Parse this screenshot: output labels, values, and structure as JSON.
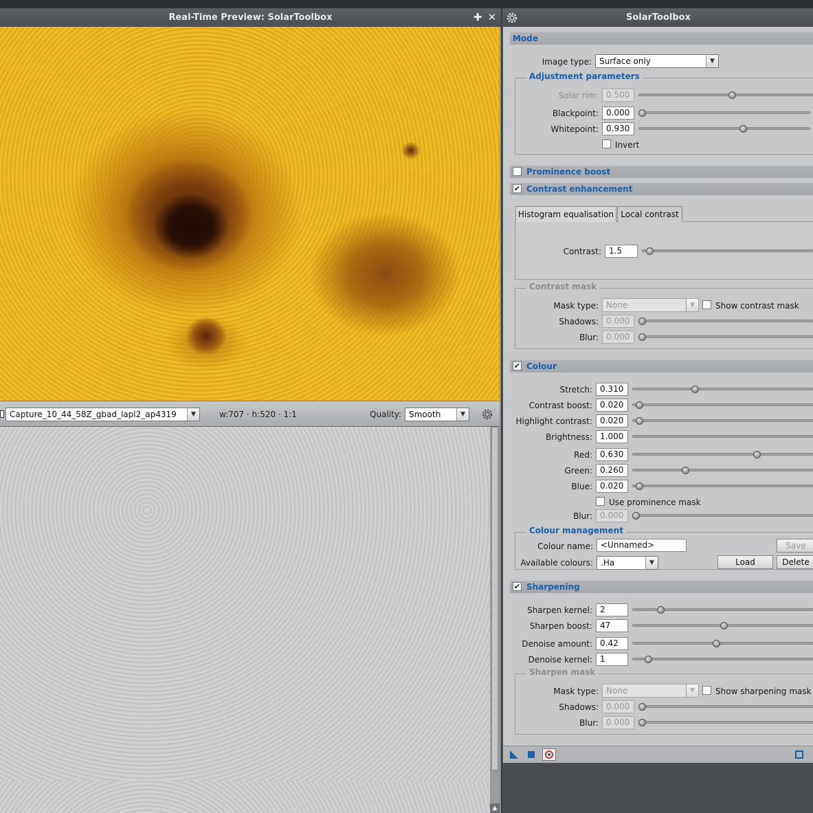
{
  "preview": {
    "title": "Real-Time Preview: SolarToolbox",
    "pin_glyph": "✚",
    "close_glyph": "✕",
    "view_selector": "Capture_10_44_58Z_gbad_lapl2_ap4319",
    "dimensions": "w:707 · h:520 · 1:1",
    "quality_label": "Quality:",
    "quality_value": "Smooth"
  },
  "panel": {
    "title": "SolarToolbox",
    "mode": {
      "header": "Mode",
      "image_type_label": "Image type:",
      "image_type_value": "Surface only",
      "adjustment_group": "Adjustment parameters",
      "solar_rim_label": "Solar rim:",
      "solar_rim_value": "0.500",
      "solar_rim_level": 0.5,
      "blackpoint_label": "Blackpoint:",
      "blackpoint_value": "0.000",
      "blackpoint_level": 0.0,
      "whitepoint_label": "Whitepoint:",
      "whitepoint_value": "0.930",
      "whitepoint_level": 0.6,
      "invert_label": "Invert",
      "invert_checked": false
    },
    "prominence": {
      "header": "Prominence boost",
      "checked": false
    },
    "contrast": {
      "header": "Contrast enhancement",
      "checked": true,
      "tabs": [
        "Histogram equalisation",
        "Local contrast"
      ],
      "contrast_label": "Contrast:",
      "contrast_value": "1.5",
      "mask_group": "Contrast mask",
      "mask_type_label": "Mask type:",
      "mask_type_value": "None",
      "show_mask_label": "Show contrast mask",
      "shadows_label": "Shadows:",
      "shadows_value": "0.000",
      "blur_label": "Blur:",
      "blur_value": "0.000"
    },
    "colour": {
      "header": "Colour",
      "checked": true,
      "stretch_label": "Stretch:",
      "stretch_value": "0.310",
      "contrast_boost_label": "Contrast boost:",
      "contrast_boost_value": "0.020",
      "highlight_contrast_label": "Highlight contrast:",
      "highlight_contrast_value": "0.020",
      "brightness_label": "Brightness:",
      "brightness_value": "1.000",
      "red_label": "Red:",
      "red_value": "0.630",
      "green_label": "Green:",
      "green_value": "0.260",
      "blue_label": "Blue:",
      "blue_value": "0.020",
      "use_prominence_mask_label": "Use prominence mask",
      "blur_label": "Blur:",
      "blur_value": "0.000",
      "management_group": "Colour management",
      "colour_name_label": "Colour name:",
      "colour_name_value": "<Unnamed>",
      "save_label": "Save",
      "available_label": "Available colours:",
      "available_value": ".Ha",
      "load_label": "Load",
      "delete_label": "Delete"
    },
    "sharpening": {
      "header": "Sharpening",
      "checked": true,
      "sharpen_kernel_label": "Sharpen kernel:",
      "sharpen_kernel_value": "2",
      "sharpen_boost_label": "Sharpen boost:",
      "sharpen_boost_value": "47",
      "denoise_amount_label": "Denoise amount:",
      "denoise_amount_value": "0.42",
      "denoise_kernel_label": "Denoise kernel:",
      "denoise_kernel_value": "1",
      "mask_group": "Sharpen mask",
      "mask_type_label": "Mask type:",
      "mask_type_value": "None",
      "show_mask_label": "Show sharpening mask",
      "shadows_label": "Shadows:",
      "shadows_value": "0.000",
      "blur_label": "Blur:",
      "blur_value": "0.000"
    },
    "check_glyph": "✔"
  },
  "colors": {
    "accent": "#1d5fa8",
    "titlebar": "#4a4e53",
    "panel_bg": "#c7c8ca"
  }
}
